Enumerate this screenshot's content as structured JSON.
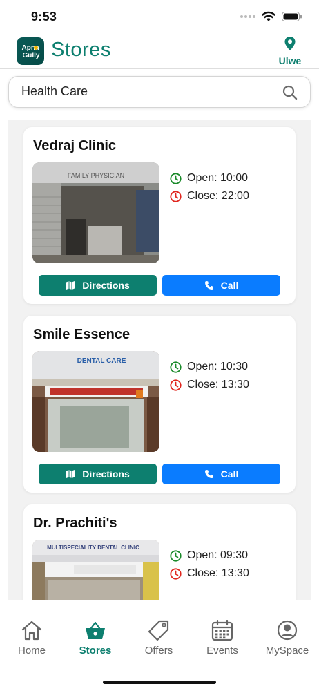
{
  "status_bar": {
    "time": "9:53"
  },
  "header": {
    "title": "Stores",
    "logo_text_top": "Apna",
    "logo_text_bottom": "Gully",
    "location_label": "Ulwe",
    "location_icon": "map-pin-icon"
  },
  "search": {
    "value": "Health Care",
    "icon": "search-icon"
  },
  "stores": [
    {
      "name": "Vedraj Clinic",
      "open": "Open: 10:00",
      "close": "Close: 22:00",
      "sign_text": "FAMILY PHYSICIAN"
    },
    {
      "name": "Smile Essence",
      "open": "Open: 10:30",
      "close": "Close: 13:30",
      "sign_text": "DENTAL CARE"
    },
    {
      "name": "Dr. Prachiti's",
      "open": "Open: 09:30",
      "close": "Close: 13:30",
      "sign_text": "MULTISPECIALITY DENTAL CLINIC"
    }
  ],
  "buttons": {
    "directions": "Directions",
    "call": "Call"
  },
  "tabs": [
    {
      "label": "Home",
      "icon": "home-icon"
    },
    {
      "label": "Stores",
      "icon": "basket-icon",
      "active": true
    },
    {
      "label": "Offers",
      "icon": "tag-icon"
    },
    {
      "label": "Events",
      "icon": "calendar-icon"
    },
    {
      "label": "MySpace",
      "icon": "user-circle-icon"
    }
  ],
  "colors": {
    "accent": "#0d7f6f",
    "call_blue": "#0a7cff",
    "open_green": "#1a8a2a",
    "close_red": "#e0261e"
  }
}
